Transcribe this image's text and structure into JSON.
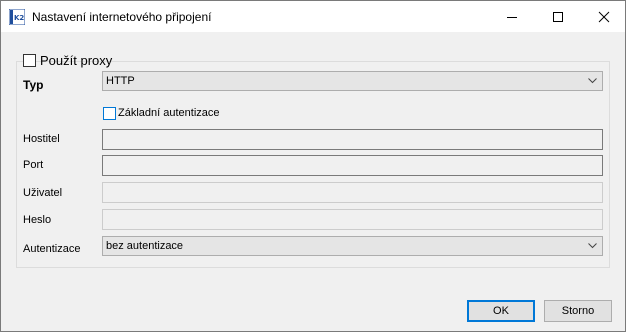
{
  "window": {
    "title": "Nastavení internetového připojení",
    "icon": "k2-app-icon"
  },
  "titlebar_buttons": [
    "minimize-icon",
    "maximize-icon",
    "close-icon"
  ],
  "proxy": {
    "use_proxy_label": "Použít proxy",
    "use_proxy_checked": false
  },
  "form": {
    "type_label": "Typ",
    "type_value": "HTTP",
    "basic_auth_label": "Základní autentizace",
    "basic_auth_checked": false,
    "host_label": "Hostitel",
    "host_value": "",
    "port_label": "Port",
    "port_value": "",
    "user_label": "Uživatel",
    "user_value": "",
    "password_label": "Heslo",
    "password_value": "",
    "auth_label": "Autentizace",
    "auth_value": "bez autentizace"
  },
  "buttons": {
    "ok_label": "OK",
    "cancel_label": "Storno"
  },
  "colors": {
    "accent": "#0078d7",
    "window_bg": "#f0f0f0",
    "titlebar_bg": "#ffffff"
  }
}
